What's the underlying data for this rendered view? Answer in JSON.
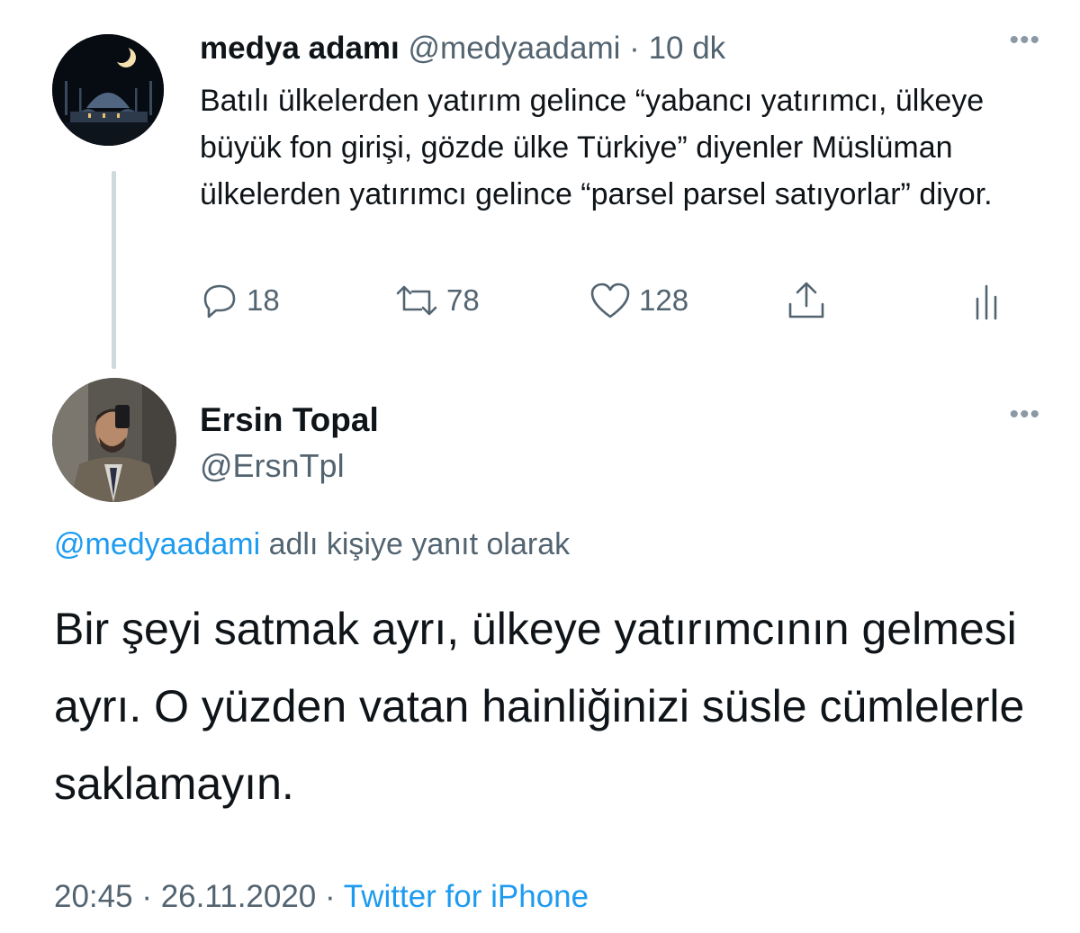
{
  "parent_tweet": {
    "display_name": "medya adamı",
    "handle": "@medyaadami",
    "separator": "·",
    "time_ago": "10 dk",
    "more_label": "•••",
    "text": "Batılı ülkelerden yatırım gelince “yabancı yatırımcı, ülkeye büyük fon girişi, gözde ülke Türkiye” diyenler Müslüman ülkelerden yatırımcı gelince “parsel parsel satıyorlar” diyor.",
    "replies": "18",
    "retweets": "78",
    "likes": "128"
  },
  "reply_tweet": {
    "display_name": "Ersin Topal",
    "handle": "@ErsnTpl",
    "more_label": "•••",
    "replying_to_mention": "@medyaadami",
    "replying_to_suffix": " adlı kişiye yanıt olarak",
    "text": "Bir şeyi satmak ayrı, ülkeye yatırımcının gelmesi ayrı. O yüzden vatan hainliğinizi süsle cümlelerle saklamayın.",
    "time": "20:45",
    "separator1": " · ",
    "date": "26.11.2020",
    "separator2": " · ",
    "source": "Twitter for iPhone"
  },
  "colors": {
    "text": "#0f1419",
    "secondary": "#536471",
    "link": "#1d9bf0",
    "thread_line": "#cfd9de"
  },
  "icons": [
    "reply-icon",
    "retweet-icon",
    "like-icon",
    "share-icon",
    "analytics-icon",
    "more-icon"
  ]
}
